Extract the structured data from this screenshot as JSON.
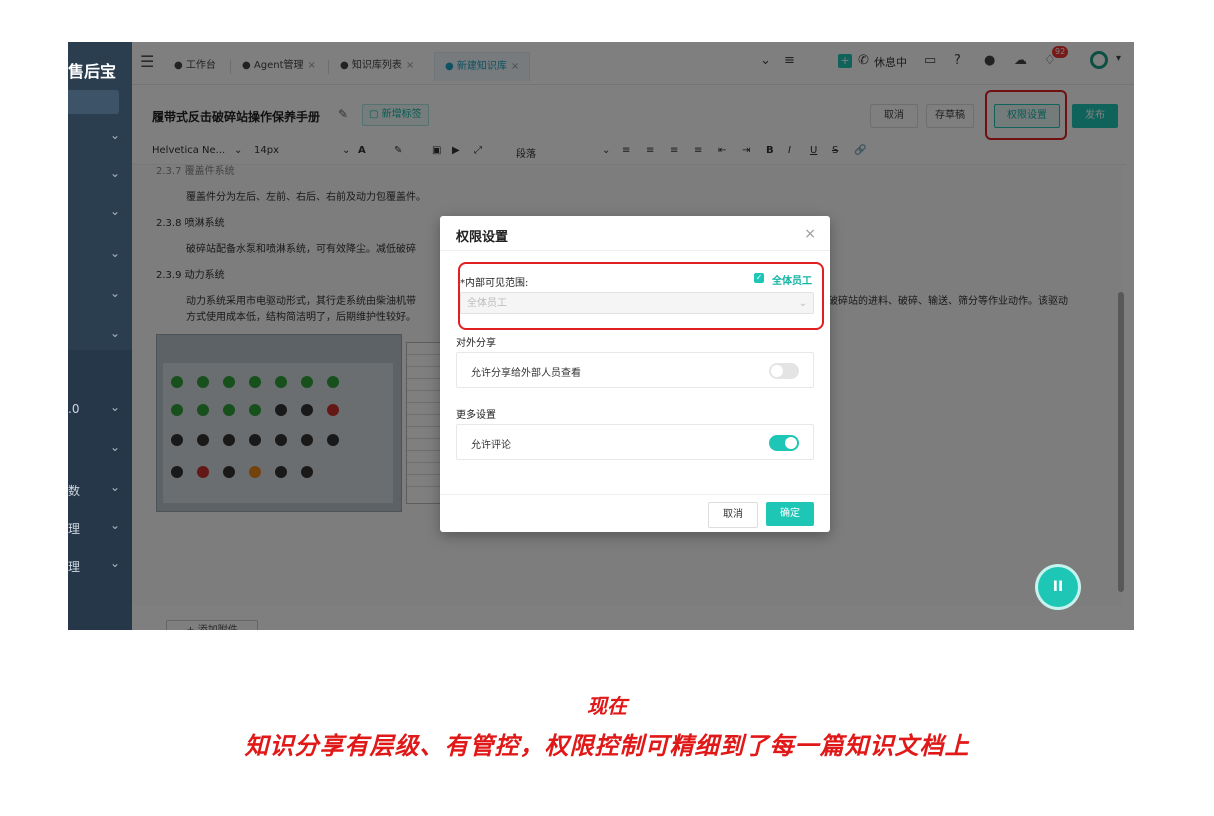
{
  "sidebar": {
    "app_name": "售后宝",
    "items": [
      {
        "label": ""
      },
      {
        "label": ""
      },
      {
        "label": ""
      },
      {
        "label": ""
      },
      {
        "label": ""
      },
      {
        "label": ""
      },
      {
        "label": ".0"
      },
      {
        "label": ""
      },
      {
        "label": "数"
      },
      {
        "label": "理"
      },
      {
        "label": "理"
      }
    ]
  },
  "tabs": [
    {
      "label": "● 工作台"
    },
    {
      "label": "● Agent管理",
      "close": "×"
    },
    {
      "label": "● 知识库列表",
      "close": "×"
    },
    {
      "label": "● 新建知识库",
      "close": "×"
    }
  ],
  "topbar": {
    "icons": [
      "chevron-down-icon",
      "list-icon",
      "add-app-icon",
      "phone-icon",
      "calendar-icon",
      "help-icon",
      "bell-icon",
      "cloud-icon",
      "notification-icon",
      "avatar"
    ],
    "status": "休息中",
    "notification_count": "92"
  },
  "doc": {
    "title": "履带式反击破碎站操作保养手册",
    "add_tag": "新增标签",
    "cancel": "取消",
    "save_draft": "存草稿",
    "permission": "权限设置",
    "publish": "发布"
  },
  "toolbar": {
    "font": "Helvetica Ne...",
    "size": "14px",
    "paragraph": "段落"
  },
  "content": {
    "s1_head": "2.3.7 覆盖件系统",
    "s1_body": "覆盖件分为左后、左前、右后、右前及动力包覆盖件。",
    "s2_head": "2.3.8 喷淋系统",
    "s2_body": "破碎站配备水泵和喷淋系统，可有效降尘。减低破碎",
    "s3_head": "2.3.9 动力系统",
    "s3_body_a": "动力系统采用市电驱动形式，其行走系统由柴油机带",
    "s3_body_b": "破碎站的进料、破碎、输送、筛分等作业动作。该驱动",
    "s3_body_c": "方式使用成本低，结构简洁明了，后期维护性较好。",
    "attach": "+ 添加附件"
  },
  "modal": {
    "title": "权限设置",
    "close": "×",
    "visible_label": "*内部可见范围:",
    "all_staff_check": "全体员工",
    "select_value": "全体员工",
    "external_label": "对外分享",
    "external_option": "允许分享给外部人员查看",
    "external_on": false,
    "more_label": "更多设置",
    "comment_option": "允许评论",
    "comment_on": true,
    "cancel": "取消",
    "ok": "确定"
  },
  "caption": {
    "line1": "现在",
    "line2": "知识分享有层级、有管控，权限控制可精细到了每一篇知识文档上"
  },
  "colors": {
    "accent": "#1ec6b6",
    "highlight": "#e02020",
    "sidebar": "#2a3e50"
  }
}
